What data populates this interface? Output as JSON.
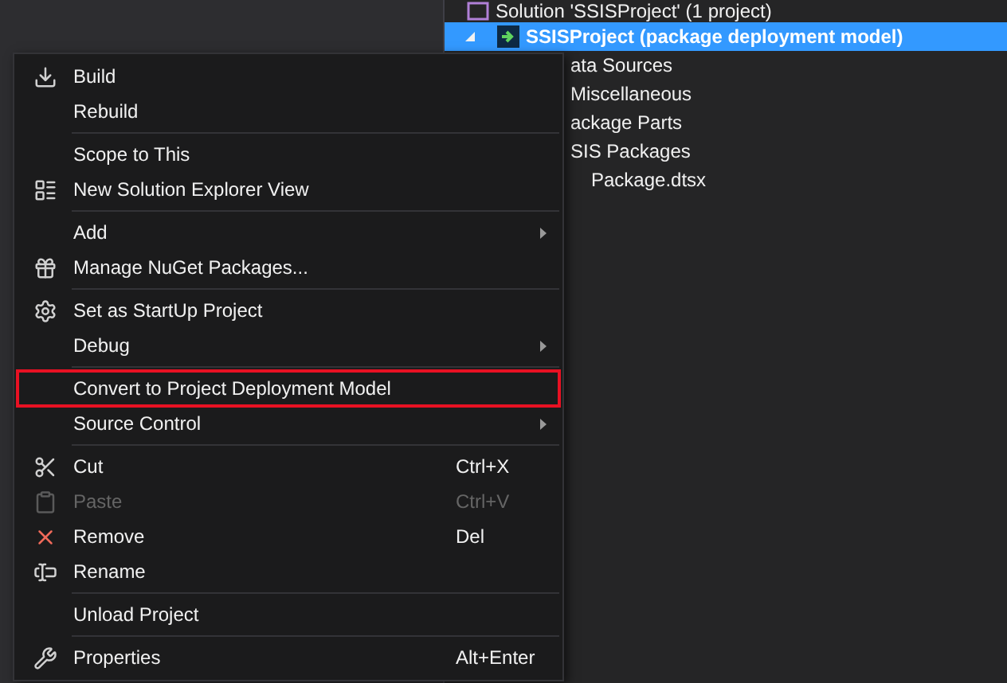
{
  "tree": {
    "solution": "Solution 'SSISProject' (1 project)",
    "project": {
      "label": "SSISProject (package deployment model)",
      "selected": true,
      "expanded": true
    },
    "children": [
      {
        "label": "ata Sources"
      },
      {
        "label": "Miscellaneous"
      },
      {
        "label": "ackage Parts"
      },
      {
        "label": "SIS Packages"
      },
      {
        "label": "Package.dtsx",
        "nested": true
      }
    ]
  },
  "context_menu": {
    "items": [
      {
        "kind": "item",
        "label": "Build",
        "submenu": false,
        "disabled": false,
        "outlined": false
      },
      {
        "kind": "item",
        "label": "Rebuild",
        "submenu": false,
        "disabled": false,
        "outlined": false
      },
      {
        "kind": "separator"
      },
      {
        "kind": "item",
        "label": "Scope to This",
        "submenu": false,
        "disabled": false,
        "outlined": false
      },
      {
        "kind": "item",
        "label": "New Solution Explorer View",
        "submenu": false,
        "disabled": false,
        "outlined": false
      },
      {
        "kind": "separator"
      },
      {
        "kind": "item",
        "label": "Add",
        "submenu": true,
        "disabled": false,
        "outlined": false
      },
      {
        "kind": "item",
        "label": "Manage NuGet Packages...",
        "submenu": false,
        "disabled": false,
        "outlined": false
      },
      {
        "kind": "separator"
      },
      {
        "kind": "item",
        "label": "Set as StartUp Project",
        "submenu": false,
        "disabled": false,
        "outlined": false
      },
      {
        "kind": "item",
        "label": "Debug",
        "submenu": true,
        "disabled": false,
        "outlined": false
      },
      {
        "kind": "separator"
      },
      {
        "kind": "item",
        "label": "Convert to Project Deployment Model",
        "submenu": false,
        "disabled": false,
        "outlined": true
      },
      {
        "kind": "item",
        "label": "Source Control",
        "submenu": true,
        "disabled": false,
        "outlined": false
      },
      {
        "kind": "separator"
      },
      {
        "kind": "item",
        "label": "Cut",
        "shortcut": "Ctrl+X",
        "submenu": false,
        "disabled": false,
        "outlined": false
      },
      {
        "kind": "item",
        "label": "Paste",
        "shortcut": "Ctrl+V",
        "submenu": false,
        "disabled": true,
        "outlined": false
      },
      {
        "kind": "item",
        "label": "Remove",
        "shortcut": "Del",
        "submenu": false,
        "disabled": false,
        "outlined": false
      },
      {
        "kind": "item",
        "label": "Rename",
        "submenu": false,
        "disabled": false,
        "outlined": false
      },
      {
        "kind": "separator"
      },
      {
        "kind": "item",
        "label": "Unload Project",
        "submenu": false,
        "disabled": false,
        "outlined": false
      },
      {
        "kind": "separator"
      },
      {
        "kind": "item",
        "label": "Properties",
        "shortcut": "Alt+Enter",
        "submenu": false,
        "disabled": false,
        "outlined": false
      }
    ]
  }
}
